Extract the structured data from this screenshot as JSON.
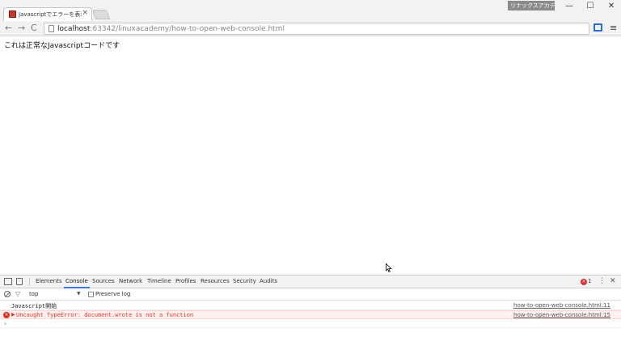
{
  "browser": {
    "tab_title": "Javascriptでエラーを表示する",
    "tab_close": "×",
    "profile_name": "リナックスアカデミー",
    "window_controls": {
      "minimize": "—",
      "maximize": "☐",
      "close": "✕"
    },
    "nav": {
      "back": "←",
      "forward": "→",
      "reload": "C"
    },
    "url_host": "localhost",
    "url_path": ":63342/linuxacademy/how-to-open-web-console.html",
    "menu_icon": "≡"
  },
  "page": {
    "text": "これは正常なJavascriptコードです"
  },
  "devtools": {
    "tabs": [
      "Elements",
      "Console",
      "Sources",
      "Network",
      "Timeline",
      "Profiles",
      "Resources",
      "Security",
      "Audits"
    ],
    "active_tab": "Console",
    "error_count": "1",
    "kebab": "⋮",
    "close": "✕",
    "filter": {
      "context": "top",
      "context_arrow": "▼",
      "preserve_log_label": "Preserve log"
    },
    "console_rows": [
      {
        "type": "log",
        "message": "Javascript開始",
        "source": "how-to-open-web-console.html:11"
      },
      {
        "type": "error",
        "message": "Uncaught TypeError: document.wrote is not a function",
        "source": "how-to-open-web-console.html:15"
      }
    ],
    "prompt": "›"
  },
  "colors": {
    "accent": "#3879d9",
    "error": "#d9302c",
    "error_bg": "#fff0f0"
  }
}
